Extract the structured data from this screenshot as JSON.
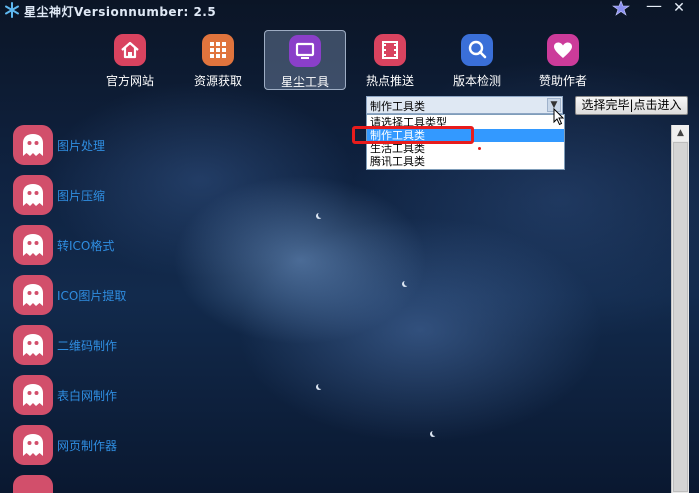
{
  "app": {
    "title": "星尘神灯Versionnumber: 2.5",
    "icon": "snowflake-icon",
    "window_controls": {
      "skin_icon": "star-icon",
      "minimize": "—",
      "close": "✕"
    }
  },
  "nav": {
    "items": [
      {
        "label": "官方网站",
        "icon": "home-icon",
        "color": "#d9435f"
      },
      {
        "label": "资源获取",
        "icon": "grid-icon",
        "color": "#e0743d"
      },
      {
        "label": "星尘工具",
        "icon": "monitor-icon",
        "color": "#8a3fc9",
        "active": true
      },
      {
        "label": "热点推送",
        "icon": "film-icon",
        "color": "#d9435f"
      },
      {
        "label": "版本检测",
        "icon": "search-icon",
        "color": "#3a6fd8"
      },
      {
        "label": "赞助作者",
        "icon": "heart-icon",
        "color": "#cc3b9a"
      }
    ]
  },
  "tool_type_select": {
    "selected_value": "制作工具类",
    "options": [
      "请选择工具类型",
      "制作工具类",
      "生活工具类",
      "腾讯工具类"
    ],
    "highlighted_option": "制作工具类"
  },
  "confirm_button": {
    "label": "选择完毕|点击进入"
  },
  "tools": {
    "icon": "ghost-icon",
    "items": [
      "图片处理",
      "图片压缩",
      "转ICO格式",
      "ICO图片提取",
      "二维码制作",
      "表白网制作",
      "网页制作器"
    ]
  },
  "colors": {
    "tool_icon_bg": "#d24f6b",
    "tool_label": "#2f8de0",
    "highlight": "#e81c1c",
    "selection": "#3399ff"
  }
}
